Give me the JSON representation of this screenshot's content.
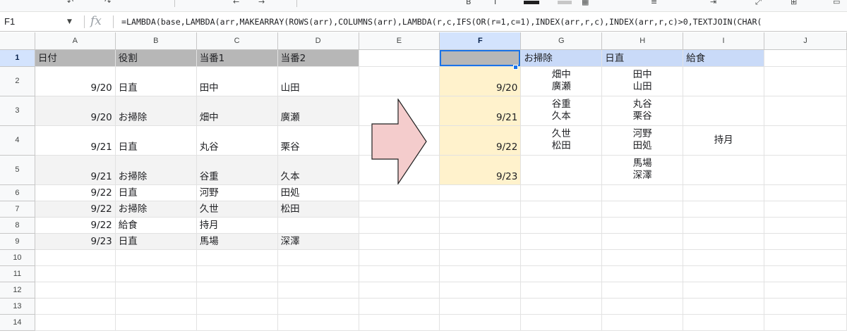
{
  "namebox": {
    "value": "F1"
  },
  "formula_bar": {
    "fx": "fx",
    "formula": "=LAMBDA(base,LAMBDA(arr,MAKEARRAY(ROWS(arr),COLUMNS(arr),LAMBDA(r,c,IFS(OR(r=1,c=1),INDEX(arr,r,c),INDEX(arr,r,c)>0,TEXTJOIN(CHAR("
  },
  "columns": [
    "A",
    "B",
    "C",
    "D",
    "E",
    "F",
    "G",
    "H",
    "I",
    "J"
  ],
  "rows": [
    "1",
    "2",
    "3",
    "4",
    "5",
    "6",
    "7",
    "8",
    "9",
    "10",
    "11",
    "12",
    "13",
    "14"
  ],
  "left_table": {
    "headers": [
      "日付",
      "役割",
      "当番1",
      "当番2"
    ],
    "rows": [
      [
        "9/20",
        "日直",
        "田中",
        "山田"
      ],
      [
        "9/20",
        "お掃除",
        "畑中",
        "廣瀬"
      ],
      [
        "9/21",
        "日直",
        "丸谷",
        "栗谷"
      ],
      [
        "9/21",
        "お掃除",
        "谷重",
        "久本"
      ],
      [
        "9/22",
        "日直",
        "河野",
        "田処"
      ],
      [
        "9/22",
        "お掃除",
        "久世",
        "松田"
      ],
      [
        "9/22",
        "給食",
        "持月",
        ""
      ],
      [
        "9/23",
        "日直",
        "馬場",
        "深澤"
      ]
    ]
  },
  "right_table": {
    "corner": "",
    "headers": [
      "お掃除",
      "日直",
      "給食"
    ],
    "dates": [
      "9/20",
      "9/21",
      "9/22",
      "9/23"
    ],
    "cells": [
      [
        [
          "畑中",
          "廣瀬"
        ],
        [
          "田中",
          "山田"
        ],
        []
      ],
      [
        [
          "谷重",
          "久本"
        ],
        [
          "丸谷",
          "栗谷"
        ],
        []
      ],
      [
        [
          "久世",
          "松田"
        ],
        [
          "河野",
          "田処"
        ],
        [
          "持月"
        ]
      ],
      [
        [],
        [
          "馬場",
          "深澤"
        ],
        []
      ]
    ]
  },
  "colors": {
    "header_gray": "#b7b7b7",
    "band_gray": "#f3f3f3",
    "date_yellow": "#fff2cc",
    "header_blue": "#c9daf8",
    "arrow_fill": "#f4cccc",
    "selection": "#1a73e8"
  },
  "icons": [
    "fx-icon",
    "namebox-dropdown-icon",
    "right-arrow-shape"
  ]
}
